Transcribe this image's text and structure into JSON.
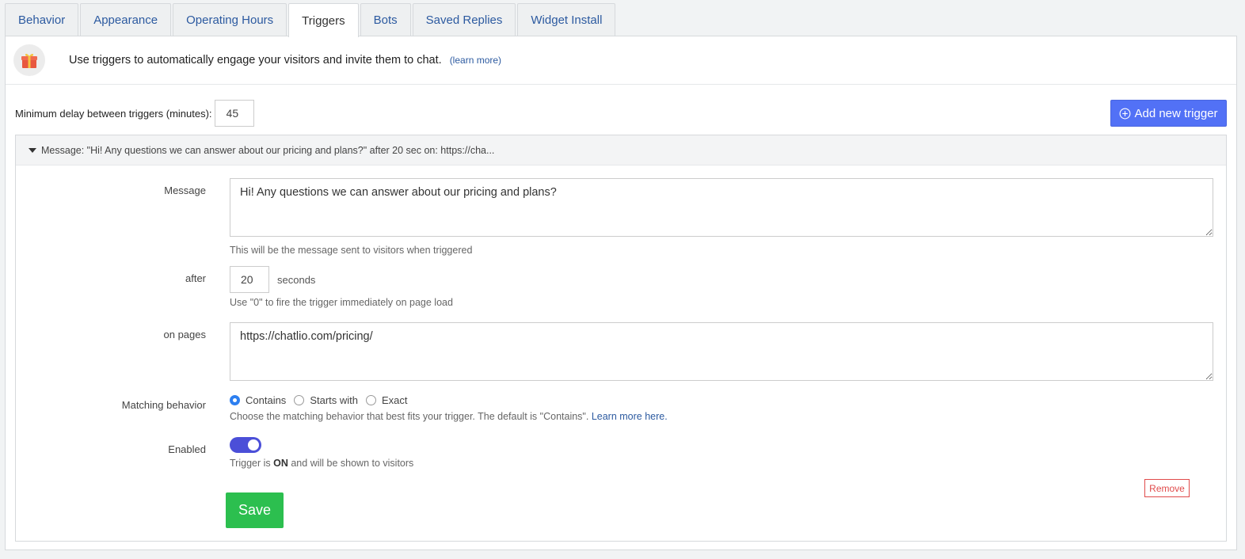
{
  "tabs": [
    {
      "label": "Behavior",
      "active": false
    },
    {
      "label": "Appearance",
      "active": false
    },
    {
      "label": "Operating Hours",
      "active": false
    },
    {
      "label": "Triggers",
      "active": true
    },
    {
      "label": "Bots",
      "active": false
    },
    {
      "label": "Saved Replies",
      "active": false
    },
    {
      "label": "Widget Install",
      "active": false
    }
  ],
  "intro": {
    "text": "Use triggers to automatically engage your visitors and invite them to chat.",
    "learn_more": "(learn more)"
  },
  "delay": {
    "label": "Minimum delay between triggers (minutes):",
    "value": "45"
  },
  "add_trigger": "Add new trigger",
  "trigger": {
    "summary": "Message: \"Hi! Any questions we can answer about our pricing and plans?\" after 20 sec on: https://cha...",
    "message_label": "Message",
    "message_value": "Hi! Any questions we can answer about our pricing and plans?",
    "message_help": "This will be the message sent to visitors when triggered",
    "after_label": "after",
    "after_value": "20",
    "after_unit": "seconds",
    "after_help": "Use \"0\" to fire the trigger immediately on page load",
    "pages_label": "on pages",
    "pages_value": "https://chatlio.com/pricing/",
    "matching_label": "Matching behavior",
    "matching_options": [
      "Contains",
      "Starts with",
      "Exact"
    ],
    "matching_selected": "Contains",
    "matching_help": "Choose the matching behavior that best fits your trigger. The default is \"Contains\".",
    "matching_link": "Learn more here.",
    "enabled_label": "Enabled",
    "enabled": true,
    "enabled_help_prefix": "Trigger is",
    "enabled_help_state": "ON",
    "enabled_help_suffix": "and will be shown to visitors",
    "remove": "Remove",
    "save": "Save"
  },
  "colors": {
    "link": "#2c5aa0",
    "primary": "#5271f6",
    "save": "#2cbf4f",
    "remove": "#e04b4b",
    "toggle": "#4b4fd8"
  }
}
